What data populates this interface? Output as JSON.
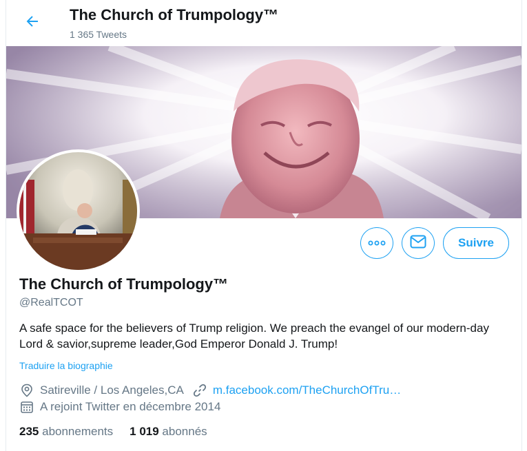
{
  "header": {
    "title": "The Church of Trumpology™",
    "tweet_count": "1 365 Tweets"
  },
  "profile": {
    "name": "The Church of Trumpology™",
    "handle": "@RealTCOT",
    "bio": "A safe space for the believers of Trump religion. We preach the evangel of our modern-day Lord & savior,supreme leader,God Emperor Donald J. Trump!",
    "translate_label": "Traduire la biographie",
    "location": "Satireville / Los Angeles,CA",
    "website": "m.facebook.com/TheChurchOfTru…",
    "joined": "A rejoint Twitter en décembre 2014",
    "following_count": "235",
    "following_label": "abonnements",
    "followers_count": "1 019",
    "followers_label": "abonnés"
  },
  "actions": {
    "more_icon": "more-icon",
    "message_icon": "envelope-icon",
    "follow_label": "Suivre"
  },
  "colors": {
    "accent": "#1da1f2",
    "text": "#14171a",
    "secondary": "#657786"
  }
}
